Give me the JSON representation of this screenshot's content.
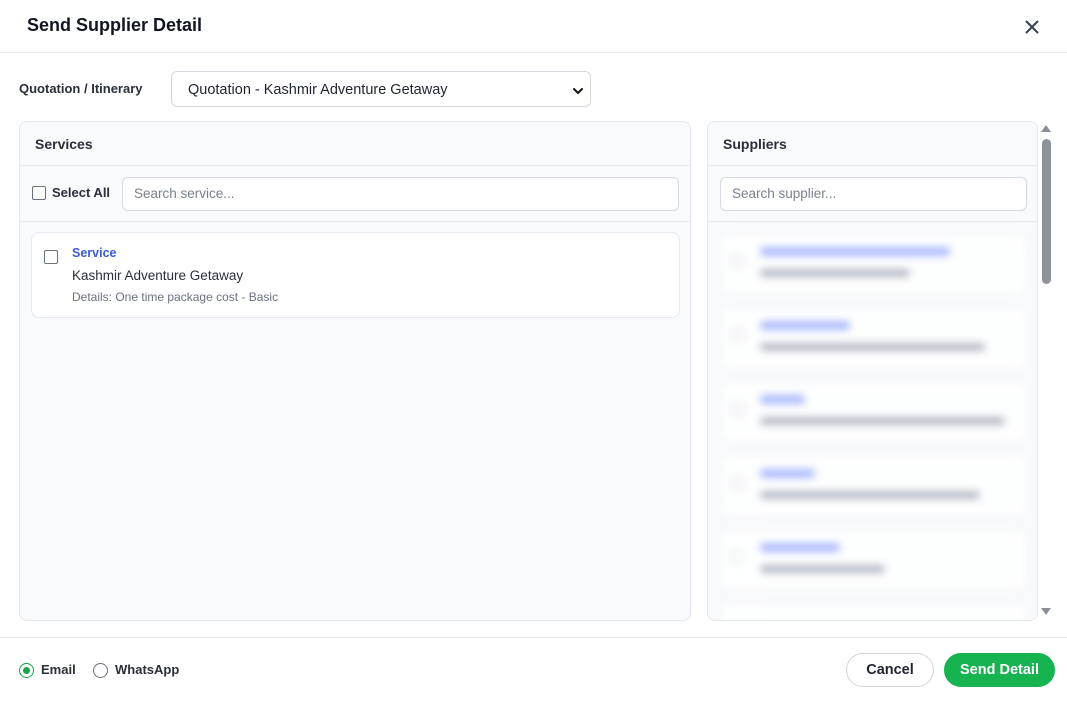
{
  "dialog": {
    "title": "Send Supplier Detail",
    "close_icon": "close-icon"
  },
  "quotation": {
    "label": "Quotation / Itinerary",
    "selected": "Quotation - Kashmir Adventure Getaway"
  },
  "services": {
    "title": "Services",
    "select_all_label": "Select All",
    "search_placeholder": "Search service...",
    "items": [
      {
        "type": "Service",
        "name": "Kashmir Adventure Getaway",
        "details": "Details: One time package cost - Basic",
        "checked": false
      }
    ]
  },
  "suppliers": {
    "title": "Suppliers",
    "search_placeholder": "Search supplier..."
  },
  "footer": {
    "channels": [
      {
        "label": "Email",
        "checked": true
      },
      {
        "label": "WhatsApp",
        "checked": false
      }
    ],
    "cancel_label": "Cancel",
    "send_label": "Send Detail"
  },
  "colors": {
    "accent_green": "#16b350",
    "service_type_blue": "#3f5bd3"
  }
}
